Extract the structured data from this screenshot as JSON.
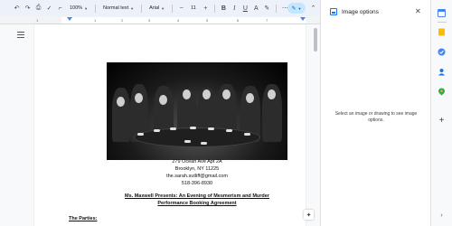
{
  "toolbar": {
    "zoom": "100%",
    "style": "Normal text",
    "font": "Arial",
    "font_size": "11",
    "bold_label": "B",
    "italic_label": "I",
    "underline_label": "U",
    "more_label": "⋯"
  },
  "ruler": {
    "numbers": [
      "1",
      "1",
      "2",
      "3",
      "4",
      "5",
      "6",
      "7"
    ]
  },
  "document": {
    "address_line1": "279 Ocean Ave Apt 2A",
    "address_line2": "Brooklyn, NY 11225",
    "email": "the.sarah.sutliff@gmail.com",
    "phone": "518-396-8930",
    "title_line1": "Ms. Maxwell Presents: An Evening of Mesmerism and Murder",
    "title_line2": "Performance Booking Agreement",
    "section_heading": "The Parties:"
  },
  "side_panel": {
    "title": "Image options",
    "message": "Select an image or drawing to see image options."
  },
  "rail": {
    "add_label": "+"
  },
  "colors": {
    "toolbar_bg": "#edf2fa",
    "accent": "#1a73e8",
    "pen_bg": "#c2e7ff"
  }
}
